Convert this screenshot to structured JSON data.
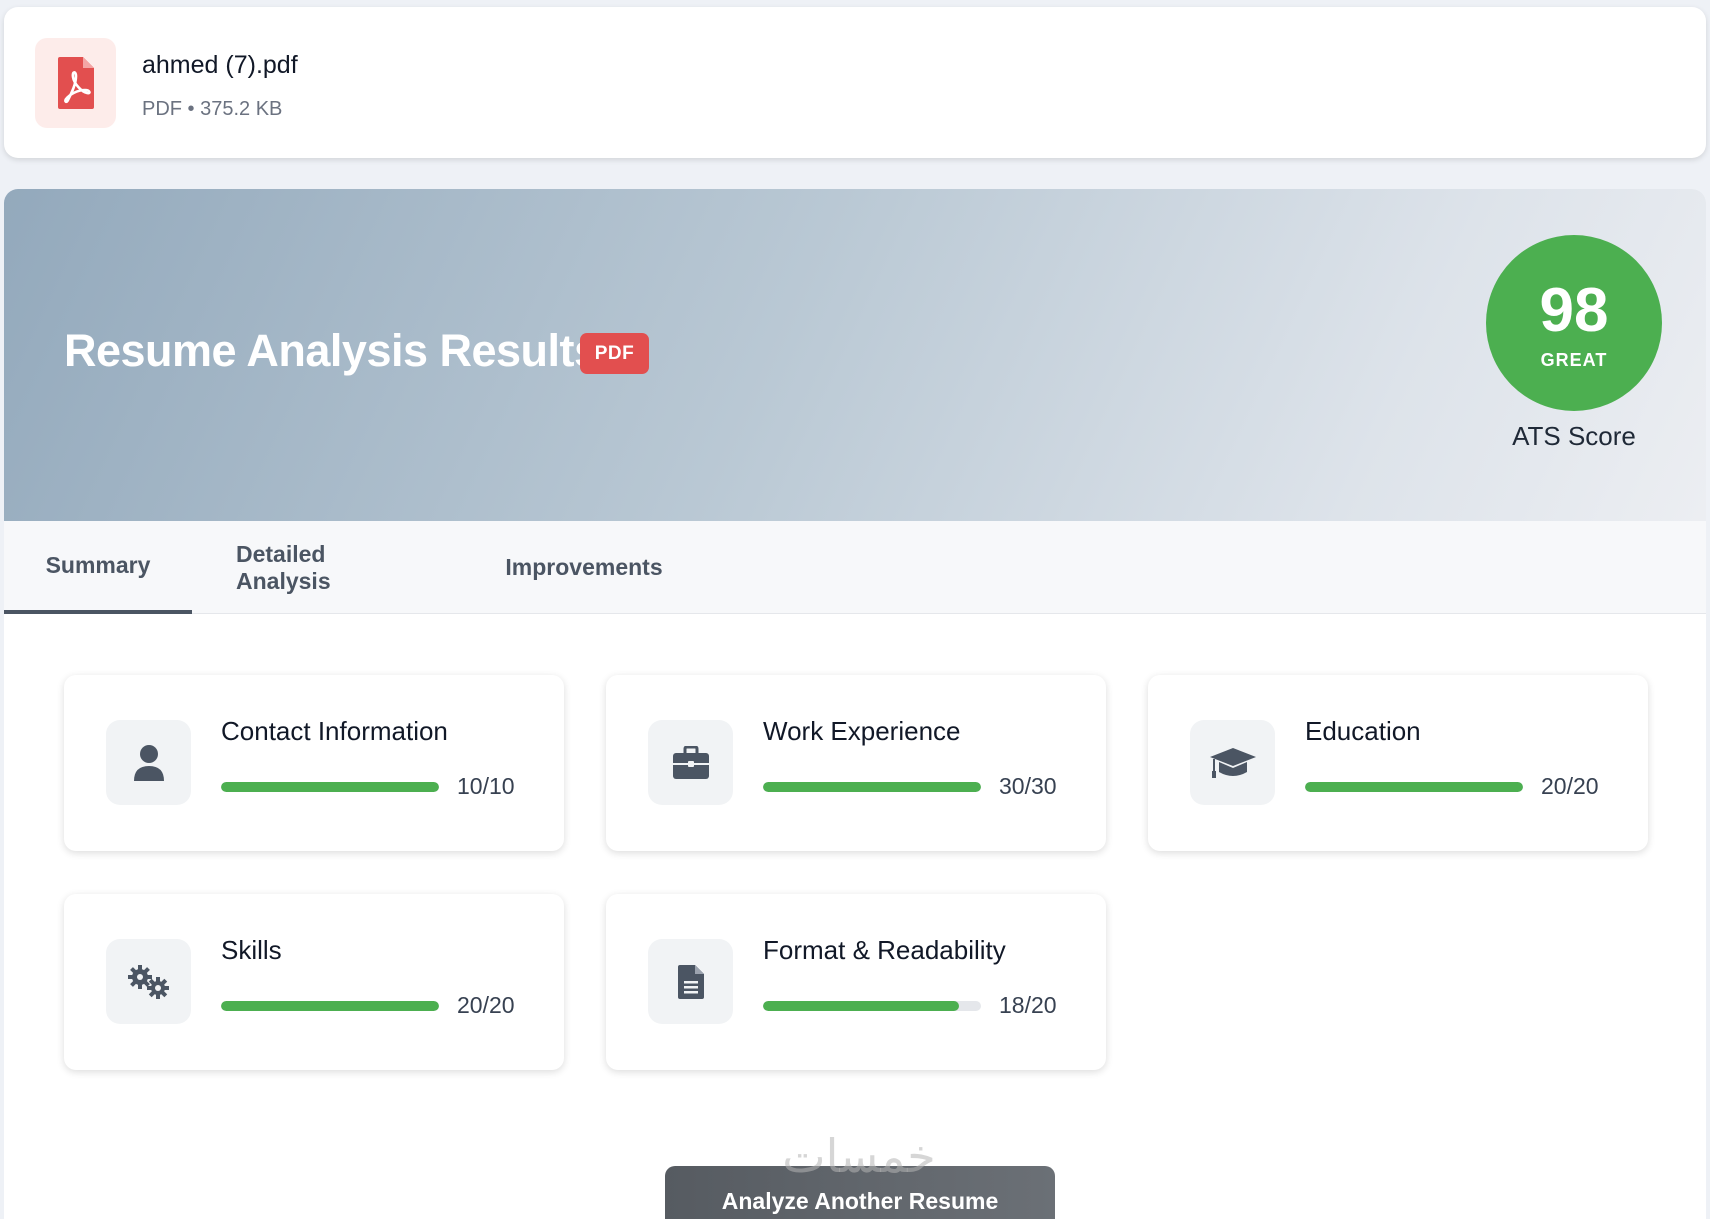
{
  "file": {
    "name": "ahmed (7).pdf",
    "meta": "PDF • 375.2 KB",
    "icon": "pdf-file-icon"
  },
  "results": {
    "title": "Resume Analysis Results",
    "format_badge": "PDF",
    "score": {
      "value": "98",
      "grade": "GREAT",
      "caption": "ATS Score",
      "color": "#4caf50"
    }
  },
  "tabs": [
    {
      "label": "Summary",
      "active": true
    },
    {
      "label": "Detailed Analysis",
      "active": false
    },
    {
      "label": "Improvements",
      "active": false
    }
  ],
  "sections": [
    {
      "title": "Contact Information",
      "score": "10/10",
      "fraction": 1.0,
      "icon": "user-icon"
    },
    {
      "title": "Work Experience",
      "score": "30/30",
      "fraction": 1.0,
      "icon": "briefcase-icon"
    },
    {
      "title": "Education",
      "score": "20/20",
      "fraction": 1.0,
      "icon": "graduation-cap-icon"
    },
    {
      "title": "Skills",
      "score": "20/20",
      "fraction": 1.0,
      "icon": "gears-icon"
    },
    {
      "title": "Format & Readability",
      "score": "18/20",
      "fraction": 0.9,
      "icon": "document-icon"
    }
  ],
  "actions": {
    "analyze_another": "Analyze Another Resume"
  },
  "watermark": "خمسات",
  "colors": {
    "accent_green": "#4caf50",
    "pdf_red": "#e24f4f"
  }
}
